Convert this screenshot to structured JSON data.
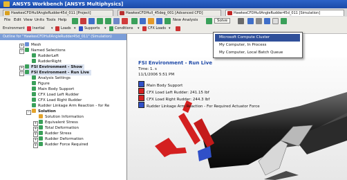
{
  "window": {
    "title": "ANSYS Workbench [ANSYS Multiphysics]"
  },
  "tabs": [
    {
      "label": "HawkesCFDHullAngleRudder45d_011 [Project]",
      "active": false
    },
    {
      "label": "HawkesCFDHull_45deg_001 [Advanced CFD]",
      "active": false
    },
    {
      "label": "HawkesCFDHullAngleRudder45d_011 [Simulation]",
      "active": true
    }
  ],
  "menubar": {
    "menus": [
      "File",
      "Edit",
      "View",
      "Units",
      "Tools",
      "Help"
    ],
    "new_analysis_label": "New Analysis",
    "solve_label": "Solve"
  },
  "toolbar2": {
    "environment_label": "Environment",
    "inertial_label": "Inertial",
    "loads_label": "Loads",
    "supports_label": "Supports",
    "conditions_label": "Conditions",
    "cfx_loads_label": "CFX Loads"
  },
  "solve_dropdown": {
    "items": [
      {
        "label": "Microsoft Compute Cluster",
        "selected": true
      },
      {
        "label": "My Computer, In Process",
        "selected": false
      },
      {
        "label": "My Computer, Local Batch Queue",
        "selected": false
      }
    ]
  },
  "outline": {
    "title": "Outline for \"HawkesCFDHullAngleRudder45d_011\" (Simulation)",
    "items": [
      {
        "label": "Mesh",
        "icon": "mesh-icon",
        "color": "#6b8fd6"
      },
      {
        "label": "Named Selections",
        "icon": "named-selection-icon",
        "color": "#3aa05a"
      },
      {
        "label": "RudderLeft",
        "icon": "selection-icon",
        "color": "#3aa05a"
      },
      {
        "label": "RudderRight",
        "icon": "selection-icon",
        "color": "#3aa05a"
      },
      {
        "label": "FSI Environment - Show",
        "icon": "environment-icon",
        "color": "#3aa05a"
      },
      {
        "label": "FSI Environment - Run Live",
        "icon": "environment-icon",
        "color": "#3aa05a"
      },
      {
        "label": "Analysis Settings",
        "icon": "settings-icon",
        "color": "#3aa05a"
      },
      {
        "label": "Figure",
        "icon": "figure-icon",
        "color": "#3aa05a"
      },
      {
        "label": "Main Body Support",
        "icon": "support-icon",
        "color": "#3aa05a"
      },
      {
        "label": "CFX Load Left Rudder",
        "icon": "load-icon",
        "color": "#3aa05a"
      },
      {
        "label": "CFX Load Right Rudder",
        "icon": "load-icon",
        "color": "#3aa05a"
      },
      {
        "label": "Rudder Linkage Arm Reaction - for Re",
        "icon": "reaction-icon",
        "color": "#3aa05a"
      },
      {
        "label": "Solution",
        "icon": "solution-icon",
        "color": "#e3a32b"
      },
      {
        "label": "Solution Information",
        "icon": "info-icon",
        "color": "#e3a32b"
      },
      {
        "label": "Equivalent Stress",
        "icon": "result-icon",
        "color": "#3aa05a"
      },
      {
        "label": "Total Deformation",
        "icon": "result-icon",
        "color": "#3aa05a"
      },
      {
        "label": "Rudder Stress",
        "icon": "result-icon",
        "color": "#3aa05a"
      },
      {
        "label": "Rudder Deformation",
        "icon": "result-icon",
        "color": "#3aa05a"
      },
      {
        "label": "Rudder Force Required",
        "icon": "result-icon",
        "color": "#3aa05a"
      }
    ]
  },
  "viewport": {
    "title": "FSI Environment - Run Live",
    "time": "Time: 1. s",
    "date": "11/1/2006 5:51 PM",
    "legend": [
      {
        "label": "Main Body Support",
        "color": "#3050c8"
      },
      {
        "label": "CFX Load Left Rudder: 241.15 lbf",
        "color": "#d42020"
      },
      {
        "label": "CFX Load Right Rudder: 244.3 lbf",
        "color": "#d42020"
      },
      {
        "label": "Rudder Linkage Arm Reaction - For Required Actuator Force",
        "color": "#3050c8"
      }
    ]
  }
}
